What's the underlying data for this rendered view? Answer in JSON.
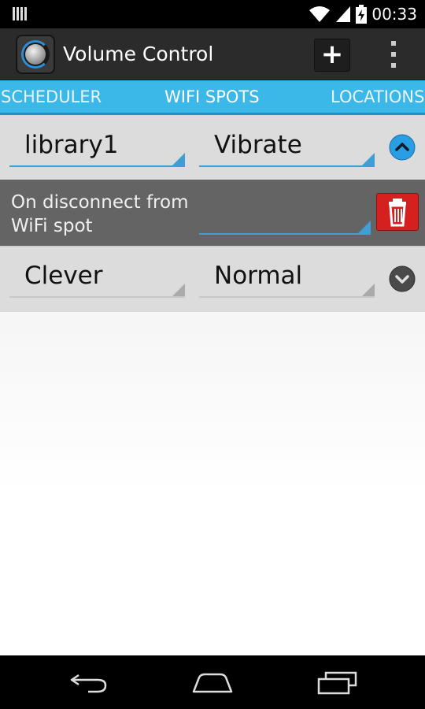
{
  "status_bar": {
    "time": "00:33",
    "icons": [
      "signal-bars-icon",
      "wifi-icon",
      "cell-signal-icon",
      "battery-charging-icon"
    ]
  },
  "action_bar": {
    "title": "Volume Control",
    "add_label": "+",
    "app_icon": "volume-knob-icon",
    "overflow_icon": "overflow-menu-icon"
  },
  "tabs": [
    {
      "label": "SCHEDULER",
      "active": false
    },
    {
      "label": "WIFI SPOTS",
      "active": true
    },
    {
      "label": "LOCATIONS",
      "active": false
    }
  ],
  "entries": [
    {
      "spot": "library1",
      "mode": "Vibrate",
      "expanded": true
    },
    {
      "spot": "Clever",
      "mode": "Normal",
      "expanded": false
    }
  ],
  "expanded_panel": {
    "disconnect_label": "On disconnect from WiFi spot",
    "disconnect_value": "",
    "delete_icon": "trash-icon"
  },
  "nav_bar": {
    "icons": [
      "back-icon",
      "home-icon",
      "recent-apps-icon"
    ]
  },
  "colors": {
    "accent": "#3cb8e8",
    "delete": "#d62020",
    "expand_active": "#2a9ee2"
  }
}
